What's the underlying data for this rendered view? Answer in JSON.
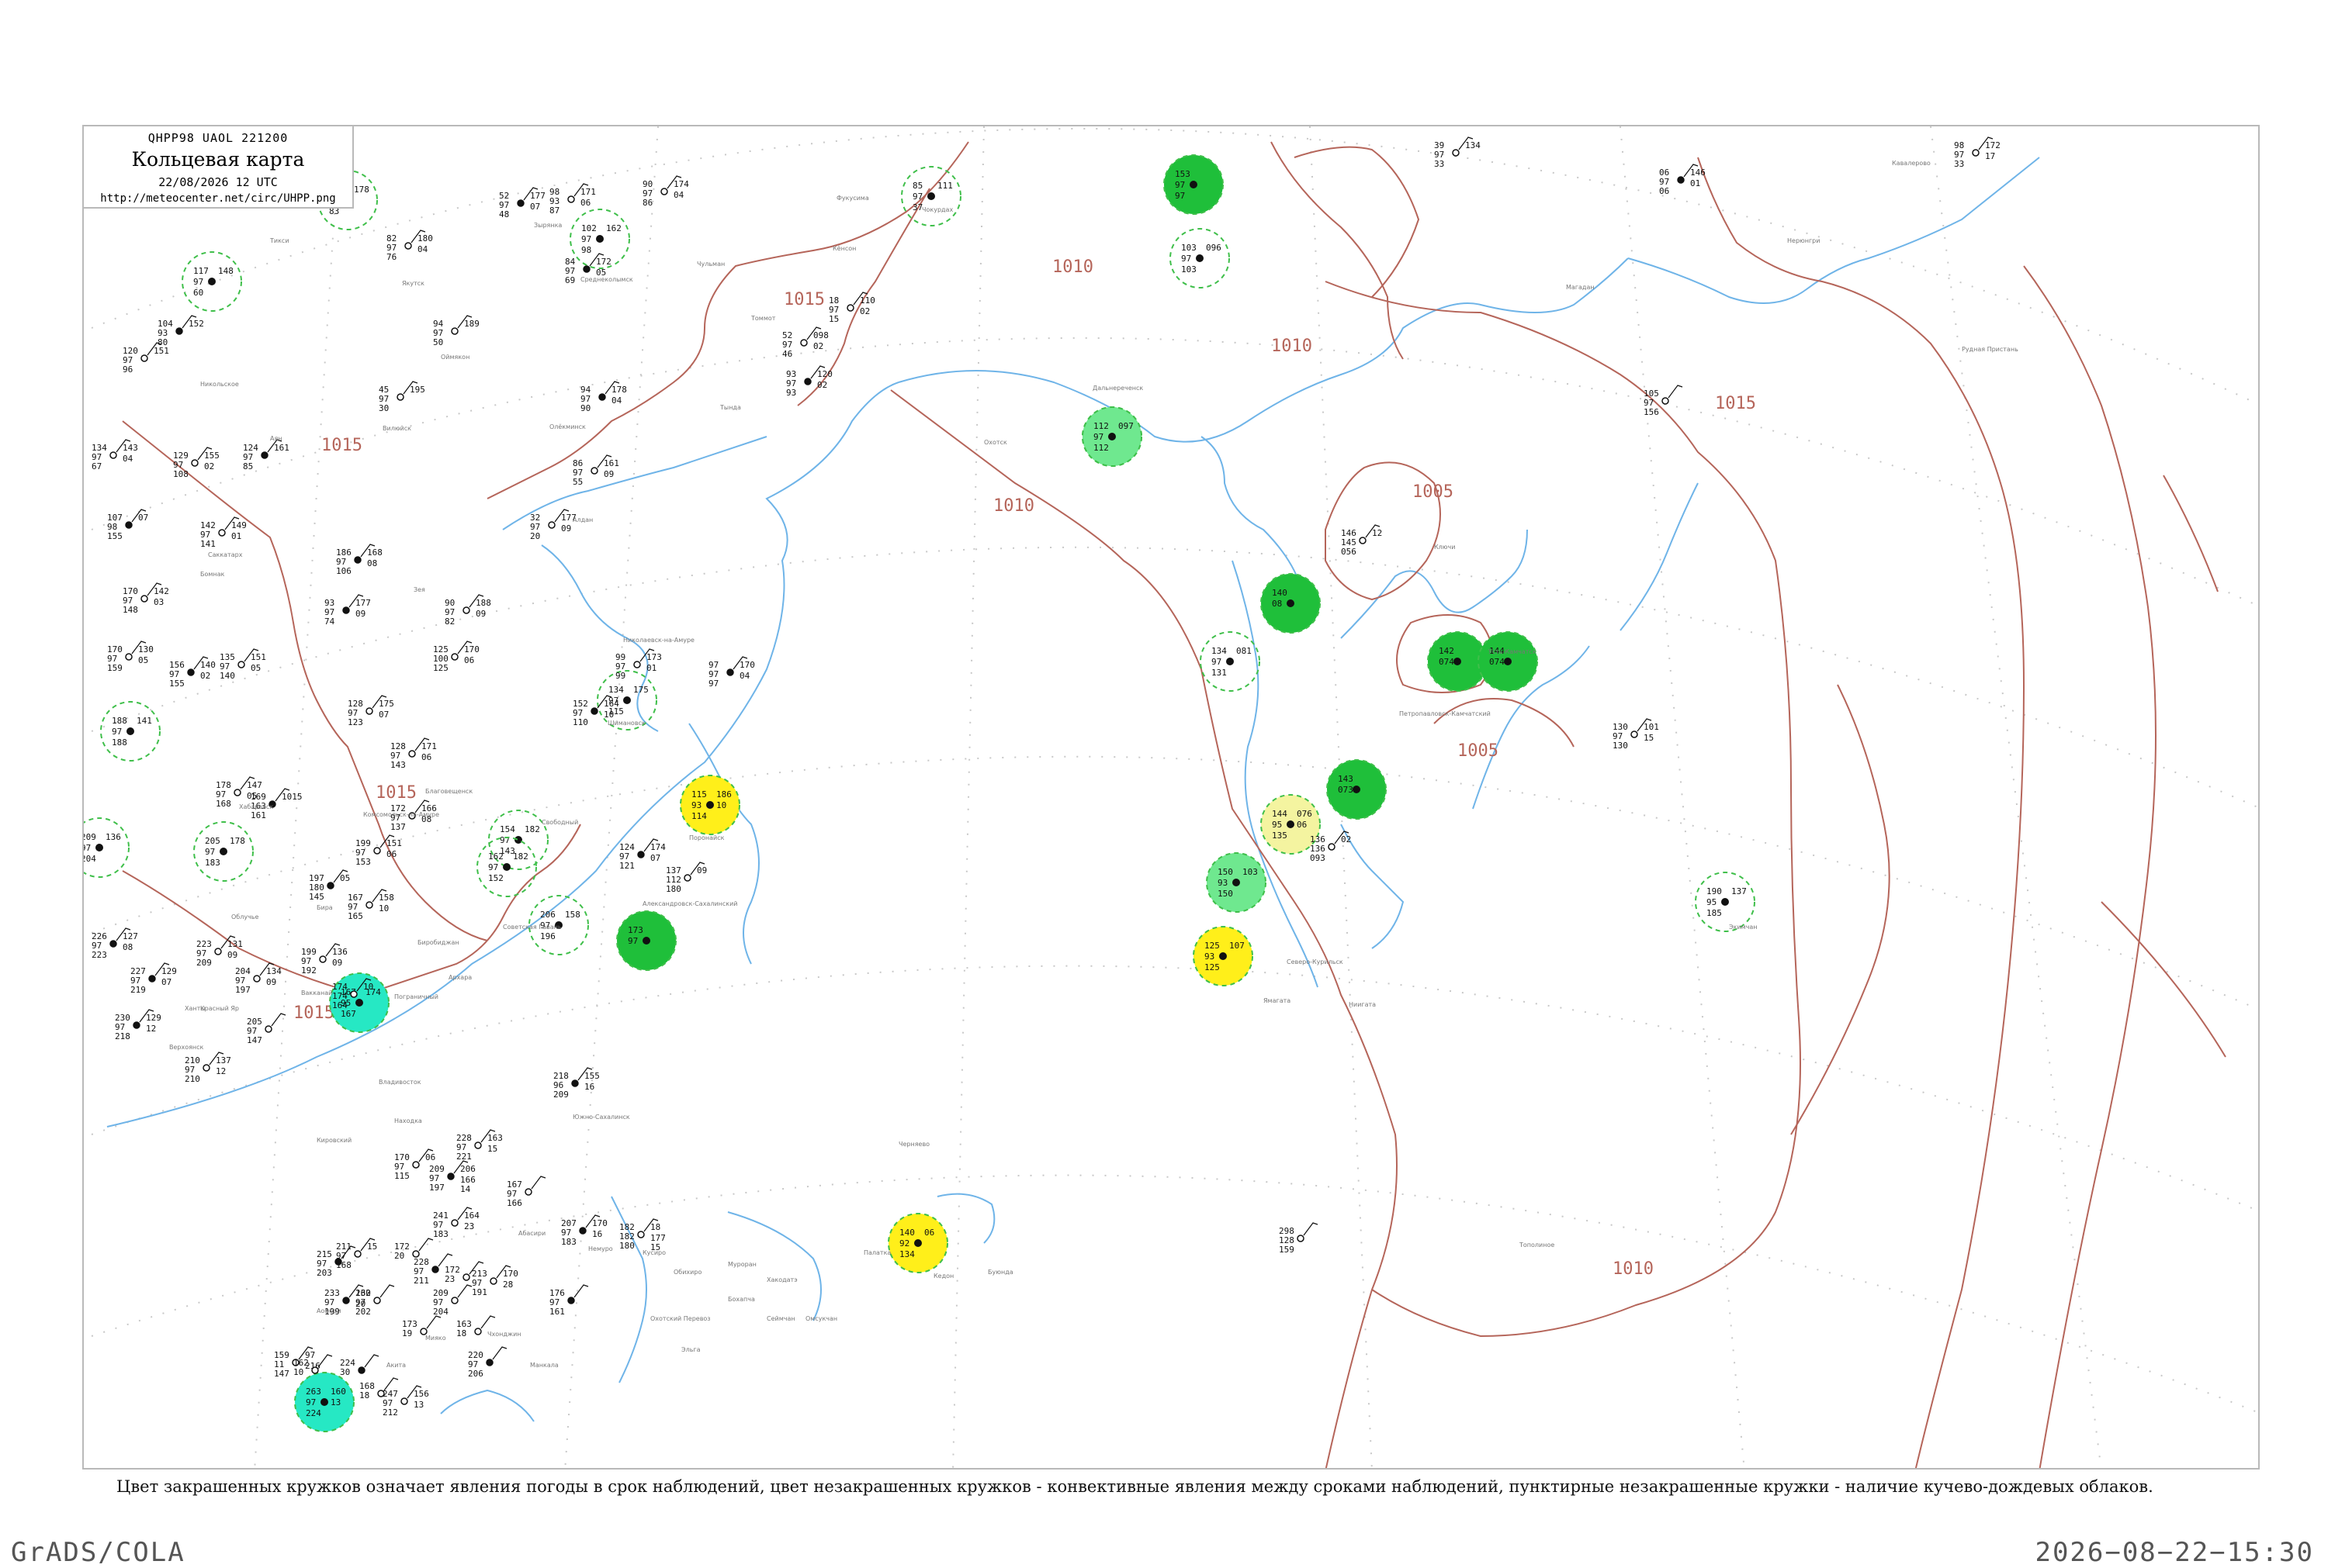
{
  "header": {
    "code": "QHPP98  UAOL  221200",
    "title": "Кольцевая карта",
    "date": "22/08/2026 12 UTC",
    "url": "http://meteocenter.net/circ/UHPP.png"
  },
  "legend_note": "Цвет закрашенных кружков означает явления погоды в срок наблюдений, цвет незакрашенных кружков - конвективные явления между сроками наблюдений, пунктирные незакрашенные кружки - наличие кучево-дождевых облаков.",
  "footer": {
    "left": "GrADS/COLA",
    "right": "2026−08−22−15:30"
  },
  "colors": {
    "isobar": "#b5655a",
    "coast": "#6fb4e8",
    "grid": "#c8c8c8",
    "rain_fill": "#1fbf3a",
    "light_rain_fill": "#6fe88f",
    "shower_fill": "#ffef1a",
    "fog_fill": "#f4f4a0",
    "snow_fill": "#26e8c4",
    "cb_dashed": "#3fbf4a"
  },
  "isobars": [
    {
      "label": "1015"
    },
    {
      "label": "1010"
    },
    {
      "label": "1010"
    },
    {
      "label": "1010"
    },
    {
      "label": "1005"
    },
    {
      "label": "1005"
    },
    {
      "label": "1015"
    },
    {
      "label": "1015"
    },
    {
      "label": "1015"
    },
    {
      "label": "1010"
    },
    {
      "label": "1015"
    }
  ],
  "highlight_stations": [
    {
      "style": "rain",
      "values": [
        "112",
        "097",
        "08"
      ]
    },
    {
      "style": "rain",
      "values": [
        "153",
        "97",
        "97"
      ]
    },
    {
      "style": "rain",
      "values": [
        "140",
        "08"
      ]
    },
    {
      "style": "rain",
      "values": [
        "142",
        "074"
      ]
    },
    {
      "style": "rain",
      "values": [
        "144",
        "074"
      ]
    },
    {
      "style": "rain",
      "values": [
        "143",
        "073"
      ]
    },
    {
      "style": "rain",
      "values": [
        "173",
        "97"
      ]
    },
    {
      "style": "shower",
      "values": [
        "115",
        "93",
        "114",
        "186",
        "10"
      ]
    },
    {
      "style": "shower",
      "values": [
        "125",
        "93",
        "125",
        "107"
      ]
    },
    {
      "style": "shower",
      "values": [
        "140",
        "92",
        "134",
        "06"
      ]
    },
    {
      "style": "fog",
      "values": [
        "144",
        "95",
        "135",
        "076",
        "06"
      ]
    },
    {
      "style": "snow",
      "values": [
        "167",
        "95",
        "167",
        "174"
      ]
    },
    {
      "style": "snow",
      "values": [
        "263",
        "97",
        "224",
        "160",
        "13"
      ]
    },
    {
      "style": "light",
      "values": [
        "112",
        "97",
        "112",
        "097"
      ]
    },
    {
      "style": "light",
      "values": [
        "150",
        "93",
        "150",
        "103"
      ]
    },
    {
      "style": "cb",
      "values": [
        "117",
        "97",
        "60",
        "148"
      ]
    },
    {
      "style": "cb",
      "values": [
        "102",
        "97",
        "98",
        "162"
      ]
    },
    {
      "style": "cb",
      "values": [
        "85",
        "97",
        "37",
        "111"
      ]
    },
    {
      "style": "cb",
      "values": [
        "103",
        "97",
        "103",
        "096"
      ]
    },
    {
      "style": "cb",
      "values": [
        "134",
        "97",
        "131",
        "081"
      ]
    },
    {
      "style": "cb",
      "values": [
        "188",
        "97",
        "188",
        "141"
      ]
    },
    {
      "style": "cb",
      "values": [
        "209",
        "97",
        "204",
        "136"
      ]
    },
    {
      "style": "cb",
      "values": [
        "205",
        "97",
        "183",
        "178"
      ]
    },
    {
      "style": "cb",
      "values": [
        "154",
        "97",
        "143",
        "182"
      ]
    },
    {
      "style": "cb",
      "values": [
        "162",
        "97",
        "152",
        "182"
      ]
    },
    {
      "style": "cb",
      "values": [
        "206",
        "97",
        "196",
        "158"
      ]
    },
    {
      "style": "cb",
      "values": [
        "134",
        "97",
        "115",
        "175"
      ]
    },
    {
      "style": "cb",
      "values": [
        "190",
        "95",
        "185",
        "137"
      ]
    },
    {
      "style": "cb",
      "values": [
        "87",
        "97",
        "83",
        "178"
      ]
    }
  ],
  "plain_stations": [
    {
      "values": [
        "52",
        "97",
        "48",
        "177",
        "07"
      ]
    },
    {
      "values": [
        "98",
        "93",
        "87",
        "171",
        "06"
      ]
    },
    {
      "values": [
        "90",
        "97",
        "86",
        "174",
        "04"
      ]
    },
    {
      "values": [
        "84",
        "97",
        "69",
        "172",
        "05"
      ]
    },
    {
      "values": [
        "82",
        "97",
        "76",
        "180",
        "04"
      ]
    },
    {
      "values": [
        "94",
        "97",
        "50",
        "189"
      ]
    },
    {
      "values": [
        "104",
        "93",
        "80",
        "152"
      ]
    },
    {
      "values": [
        "120",
        "97",
        "96",
        "151"
      ]
    },
    {
      "values": [
        "45",
        "97",
        "30",
        "195"
      ]
    },
    {
      "values": [
        "94",
        "97",
        "90",
        "178",
        "04"
      ]
    },
    {
      "values": [
        "18",
        "97",
        "15",
        "110",
        "02"
      ]
    },
    {
      "values": [
        "52",
        "97",
        "46",
        "098",
        "02"
      ]
    },
    {
      "values": [
        "93",
        "97",
        "93",
        "120",
        "02"
      ]
    },
    {
      "values": [
        "39",
        "97",
        "33",
        "134"
      ]
    },
    {
      "values": [
        "98",
        "97",
        "33",
        "172",
        "17"
      ]
    },
    {
      "values": [
        "06",
        "97",
        "06",
        "146",
        "01"
      ]
    },
    {
      "values": [
        "105",
        "97",
        "156"
      ]
    },
    {
      "values": [
        "134",
        "97",
        "67",
        "143",
        "04"
      ]
    },
    {
      "values": [
        "124",
        "97",
        "85",
        "161"
      ]
    },
    {
      "values": [
        "129",
        "97",
        "108",
        "155",
        "02"
      ]
    },
    {
      "values": [
        "86",
        "97",
        "55",
        "161",
        "09"
      ]
    },
    {
      "values": [
        "107",
        "98",
        "155",
        "07"
      ]
    },
    {
      "values": [
        "142",
        "97",
        "141",
        "149",
        "01"
      ]
    },
    {
      "values": [
        "32",
        "97",
        "20",
        "177",
        "09"
      ]
    },
    {
      "values": [
        "186",
        "97",
        "106",
        "168",
        "08"
      ]
    },
    {
      "values": [
        "146",
        "145",
        "056",
        "12"
      ]
    },
    {
      "values": [
        "170",
        "97",
        "148",
        "142",
        "03"
      ]
    },
    {
      "values": [
        "93",
        "97",
        "74",
        "177",
        "09"
      ]
    },
    {
      "values": [
        "90",
        "97",
        "82",
        "188",
        "09"
      ]
    },
    {
      "values": [
        "170",
        "97",
        "159",
        "130",
        "05"
      ]
    },
    {
      "values": [
        "156",
        "97",
        "155",
        "140",
        "02"
      ]
    },
    {
      "values": [
        "135",
        "97",
        "140",
        "151",
        "05"
      ]
    },
    {
      "values": [
        "99",
        "97",
        "99",
        "173",
        "01"
      ]
    },
    {
      "values": [
        "97",
        "97",
        "97",
        "170",
        "04"
      ]
    },
    {
      "values": [
        "125",
        "100",
        "125",
        "170",
        "06"
      ]
    },
    {
      "values": [
        "128",
        "97",
        "123",
        "175",
        "07"
      ]
    },
    {
      "values": [
        "152",
        "97",
        "110",
        "164",
        "10"
      ]
    },
    {
      "values": [
        "130",
        "97",
        "130",
        "101",
        "15"
      ]
    },
    {
      "values": [
        "178",
        "97",
        "168",
        "147",
        "05"
      ]
    },
    {
      "values": [
        "169",
        "163",
        "161",
        "1015"
      ]
    },
    {
      "values": [
        "128",
        "97",
        "143",
        "171",
        "06"
      ]
    },
    {
      "values": [
        "172",
        "97",
        "137",
        "166",
        "08"
      ]
    },
    {
      "values": [
        "124",
        "97",
        "121",
        "174",
        "07"
      ]
    },
    {
      "values": [
        "136",
        "136",
        "093",
        "02"
      ]
    },
    {
      "values": [
        "199",
        "97",
        "153",
        "151",
        "06"
      ]
    },
    {
      "values": [
        "197",
        "180",
        "145",
        "05"
      ]
    },
    {
      "values": [
        "167",
        "97",
        "165",
        "158",
        "10"
      ]
    },
    {
      "values": [
        "137",
        "112",
        "180",
        "09"
      ]
    },
    {
      "values": [
        "226",
        "97",
        "223",
        "127",
        "08"
      ]
    },
    {
      "values": [
        "223",
        "97",
        "209",
        "131",
        "09"
      ]
    },
    {
      "values": [
        "199",
        "97",
        "192",
        "136",
        "09"
      ]
    },
    {
      "values": [
        "227",
        "97",
        "219",
        "129",
        "07"
      ]
    },
    {
      "values": [
        "204",
        "97",
        "197",
        "134",
        "09"
      ]
    },
    {
      "values": [
        "174",
        "174",
        "164",
        "10"
      ]
    },
    {
      "values": [
        "230",
        "97",
        "218",
        "129",
        "12"
      ]
    },
    {
      "values": [
        "205",
        "97",
        "147"
      ]
    },
    {
      "values": [
        "210",
        "97",
        "210",
        "137",
        "12"
      ]
    },
    {
      "values": [
        "218",
        "96",
        "209",
        "155",
        "16"
      ]
    },
    {
      "values": [
        "228",
        "97",
        "221",
        "163",
        "15"
      ]
    },
    {
      "values": [
        "170",
        "97",
        "115",
        "06"
      ]
    },
    {
      "values": [
        "209",
        "97",
        "197",
        "206",
        "166",
        "14"
      ]
    },
    {
      "values": [
        "241",
        "97",
        "183",
        "164",
        "23"
      ]
    },
    {
      "values": [
        "167",
        "97",
        "166"
      ]
    },
    {
      "values": [
        "207",
        "97",
        "183",
        "170",
        "16"
      ]
    },
    {
      "values": [
        "182",
        "182",
        "180",
        "18",
        "177",
        "15"
      ]
    },
    {
      "values": [
        "298",
        "128",
        "159"
      ]
    },
    {
      "values": [
        "215",
        "97",
        "203"
      ]
    },
    {
      "values": [
        "211",
        "97",
        "168",
        "15"
      ]
    },
    {
      "values": [
        "172",
        "20"
      ]
    },
    {
      "values": [
        "228",
        "97",
        "211"
      ]
    },
    {
      "values": [
        "172",
        "23"
      ]
    },
    {
      "values": [
        "213",
        "97",
        "191",
        "170",
        "28"
      ]
    },
    {
      "values": [
        "233",
        "97",
        "199",
        "162",
        "20"
      ]
    },
    {
      "values": [
        "230",
        "97",
        "202"
      ]
    },
    {
      "values": [
        "209",
        "97",
        "204"
      ]
    },
    {
      "values": [
        "176",
        "97",
        "161"
      ]
    },
    {
      "values": [
        "173",
        "19"
      ]
    },
    {
      "values": [
        "163",
        "18"
      ]
    },
    {
      "values": [
        "220",
        "97",
        "206"
      ]
    },
    {
      "values": [
        "159",
        "11",
        "147",
        "97",
        "216"
      ]
    },
    {
      "values": [
        "162",
        "10"
      ]
    },
    {
      "values": [
        "224",
        "30"
      ]
    },
    {
      "values": [
        "168",
        "18"
      ]
    },
    {
      "values": [
        "247",
        "97",
        "212",
        "156",
        "13"
      ]
    }
  ],
  "place_names": [
    "Тикси",
    "Чокурдах",
    "Зырянка",
    "Среднеколымск",
    "Оймякон",
    "Якутск",
    "Охотск",
    "Магадан",
    "Аян",
    "Николаевск-на-Амуре",
    "Александровск-Сахалинский",
    "Поронайск",
    "Южно-Сахалинск",
    "Хабаровск",
    "Комсомольск-на-Амуре",
    "Советская Гавань",
    "Владивосток",
    "Находка",
    "Северо-Курильск",
    "Петропавловск-Камчатский",
    "Усть-Камчатск",
    "Ключи",
    "Никольское",
    "Вилюйск",
    "Олёкминск",
    "Алдан",
    "Томмот",
    "Чульман",
    "Нерюнгри",
    "Тында",
    "Благовещенск",
    "Бира",
    "Облучье",
    "Биробиджан",
    "Пограничный",
    "Ханты",
    "Верхоянск",
    "Тополиное",
    "Экимчан",
    "Бомнак",
    "Зея",
    "Шимановск",
    "Свободный",
    "Архара",
    "Черняево",
    "Кировский",
    "Красный Яр",
    "Дальнереченск",
    "Кавалерово",
    "Рудная Пристань",
    "Саккатарх",
    "Вакканай",
    "Абасири",
    "Немуро",
    "Кусиро",
    "Обихиро",
    "Муроран",
    "Хакодатэ",
    "Аомори",
    "Акита",
    "Мияко",
    "Ямагата",
    "Ниигата",
    "Фукусима",
    "Кёнсон",
    "Чхонджин",
    "Манкала",
    "Охотский Перевоз",
    "Эльга",
    "Бохапча",
    "Сеймчан",
    "Омсукчан",
    "Палатка",
    "Кедон",
    "Буюнда"
  ]
}
